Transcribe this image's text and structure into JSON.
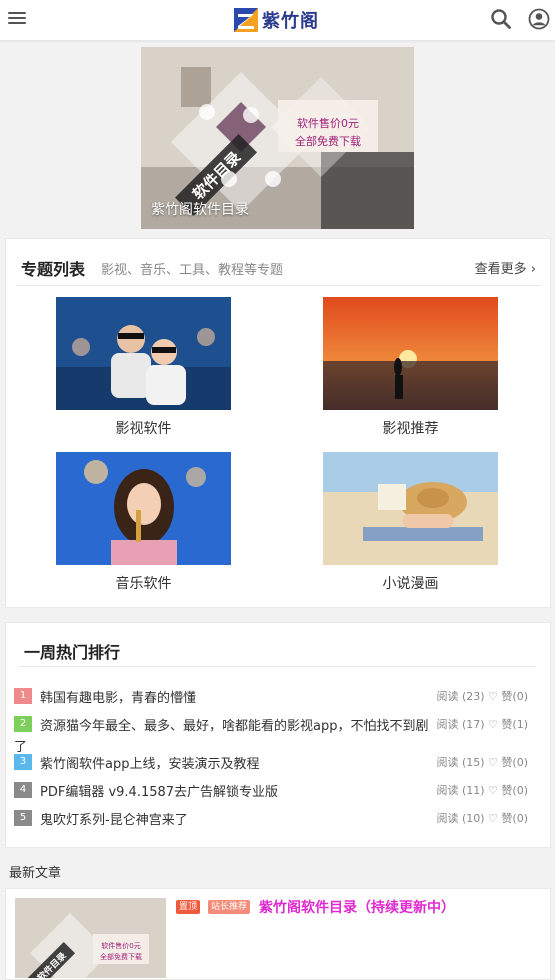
{
  "header": {
    "logo_text": "紫竹阁"
  },
  "banner": {
    "caption": "紫竹阁软件目录",
    "diamond_text": "软件目录",
    "sign_line1": "软件售价0元",
    "sign_line2": "全部免费下载"
  },
  "topics": {
    "title": "专题列表",
    "subtitle": "影视、音乐、工具、教程等专题",
    "more": "查看更多",
    "items": [
      {
        "label": "影视软件"
      },
      {
        "label": "影视推荐"
      },
      {
        "label": "音乐软件"
      },
      {
        "label": "小说漫画"
      }
    ]
  },
  "hot": {
    "title": "一周热门排行",
    "items": [
      {
        "rank": "1",
        "title": "韩国有趣电影，青春的懵懂",
        "meta": "阅读 (23) ♡ 赞(0)",
        "color": "#f08a8a"
      },
      {
        "rank": "2",
        "title": "资源猫今年最全、最多、最好，啥都能看的影视app，不怕找不到剧",
        "wrap": "了",
        "meta": "阅读 (17) ♡ 赞(1)",
        "color": "#7ccf5a"
      },
      {
        "rank": "3",
        "title": "紫竹阁软件app上线，安装演示及教程",
        "meta": "阅读 (15) ♡ 赞(0)",
        "color": "#5bb8ec"
      },
      {
        "rank": "4",
        "title": "PDF编辑器 v9.4.1587去广告解锁专业版",
        "meta": "阅读 (11) ♡ 赞(0)",
        "color": "#8a8a8a"
      },
      {
        "rank": "5",
        "title": "鬼吹灯系列-昆仑神宫来了",
        "meta": "阅读 (10) ♡ 赞(0)",
        "color": "#8a8a8a"
      }
    ]
  },
  "latest": {
    "label": "最新文章",
    "article": {
      "badge_top": "置顶",
      "badge_rec": "站长推荐",
      "title": "紫竹阁软件目录（持续更新中）",
      "thumb_line1": "软件售价0元",
      "thumb_line2": "全部免费下载",
      "thumb_diamond": "软件目录"
    }
  },
  "colors": {
    "accent_pink": "#e02ad0",
    "badge_top": "#f05a3c",
    "badge_rec": "#f58c7a",
    "brand_blue": "#2a3a8c"
  }
}
